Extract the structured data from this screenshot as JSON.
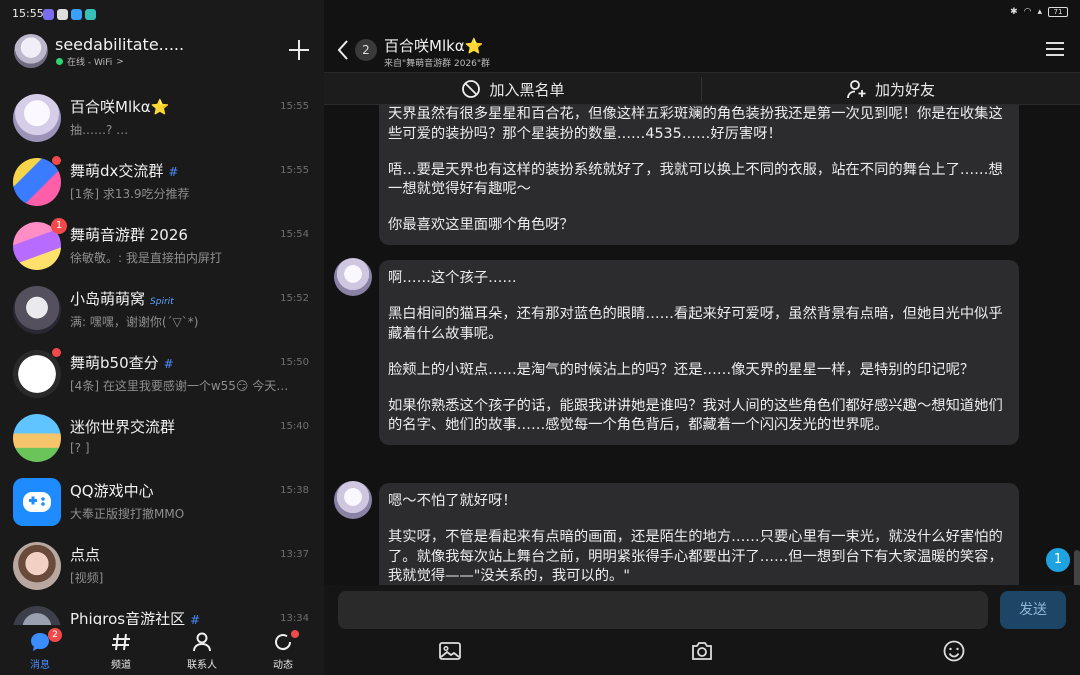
{
  "status_bar": {
    "time": "15:55",
    "battery": "71"
  },
  "account": {
    "name": "seedabilitate.....",
    "status": "在线 - WiFi",
    "status_chevron": ">"
  },
  "conversations": [
    {
      "name": "百合咲Mlkα⭐",
      "preview": "抽……?  …",
      "time": "15:55",
      "badge": "",
      "has_dot": false,
      "tag": ""
    },
    {
      "name": "舞萌dx交流群",
      "preview": "[1条] 求13.9吃分推荐",
      "time": "15:55",
      "badge": "",
      "has_dot": true,
      "tag": "#"
    },
    {
      "name": "舞萌音游群 2026",
      "preview": "徐敏敬。: 我是直接拍内屏打",
      "time": "15:54",
      "badge": "1",
      "has_dot": false,
      "tag": ""
    },
    {
      "name": "小岛萌萌窝",
      "preview": "满: 嘿嘿，谢谢你(´▽`*)",
      "time": "15:52",
      "badge": "",
      "has_dot": false,
      "tag": "Spirit"
    },
    {
      "name": "舞萌b50查分",
      "preview": "[4条] 在这里我要感谢一个w55😏 今天…",
      "time": "15:50",
      "badge": "",
      "has_dot": true,
      "tag": "#"
    },
    {
      "name": "迷你世界交流群",
      "preview": "[? ]",
      "time": "15:40",
      "badge": "",
      "has_dot": false,
      "tag": ""
    },
    {
      "name": "QQ游戏中心",
      "preview": "大奉正版搜打撤MMO",
      "time": "15:38",
      "badge": "",
      "has_dot": false,
      "tag": ""
    },
    {
      "name": "点点",
      "preview": "[视频]",
      "time": "13:37",
      "badge": "",
      "has_dot": false,
      "tag": ""
    },
    {
      "name": "Phigros音游社区",
      "preview": "",
      "time": "13:34",
      "badge": "",
      "has_dot": false,
      "tag": "#"
    }
  ],
  "bottom_nav": [
    {
      "label": "消息",
      "badge": "2",
      "active": true
    },
    {
      "label": "频道",
      "badge": "",
      "active": false
    },
    {
      "label": "联系人",
      "badge": "",
      "active": false
    },
    {
      "label": "动态",
      "badge": "",
      "active": false
    }
  ],
  "chat": {
    "title": "百合咲Mlkα⭐",
    "subtitle": "来自\"舞萌音游群 2026\"群",
    "unread_count": "2",
    "actions": {
      "block": "加入黑名单",
      "add_friend": "加为好友"
    },
    "messages": [
      {
        "paragraphs": [
          "天界虽然有很多星星和百合花，但像这样五彩斑斓的角色装扮我还是第一次见到呢！你是在收集这些可爱的装扮吗？那个星装扮的数量……4535……好厉害呀！",
          "唔…要是天界也有这样的装扮系统就好了，我就可以换上不同的衣服，站在不同的舞台上了……想一想就觉得好有趣呢～",
          "你最喜欢这里面哪个角色呀？"
        ]
      },
      {
        "paragraphs": [
          "啊……这个孩子……",
          "黑白相间的猫耳朵，还有那对蓝色的眼睛……看起来好可爱呀，虽然背景有点暗，但她目光中似乎藏着什么故事呢。",
          "脸颊上的小斑点……是淘气的时候沾上的吗？还是……像天界的星星一样，是特别的印记呢？",
          "如果你熟悉这个孩子的话，能跟我讲讲她是谁吗？我对人间的这些角色们都好感兴趣～想知道她们的名字、她们的故事……感觉每一个角色背后，都藏着一个闪闪发光的世界呢。"
        ]
      },
      {
        "paragraphs": [
          "嗯～不怕了就好呀！",
          "其实呀，不管是看起来有点暗的画面，还是陌生的地方……只要心里有一束光，就没什么好害怕的了。就像我每次站上舞台之前，明明紧张得手心都要出汗了……但一想到台下有大家温暖的笑容，我就觉得——\"没关系的，我可以的。\""
        ]
      }
    ],
    "float_badge": "1",
    "input": {
      "value": "",
      "placeholder": ""
    },
    "send_label": "发送"
  }
}
